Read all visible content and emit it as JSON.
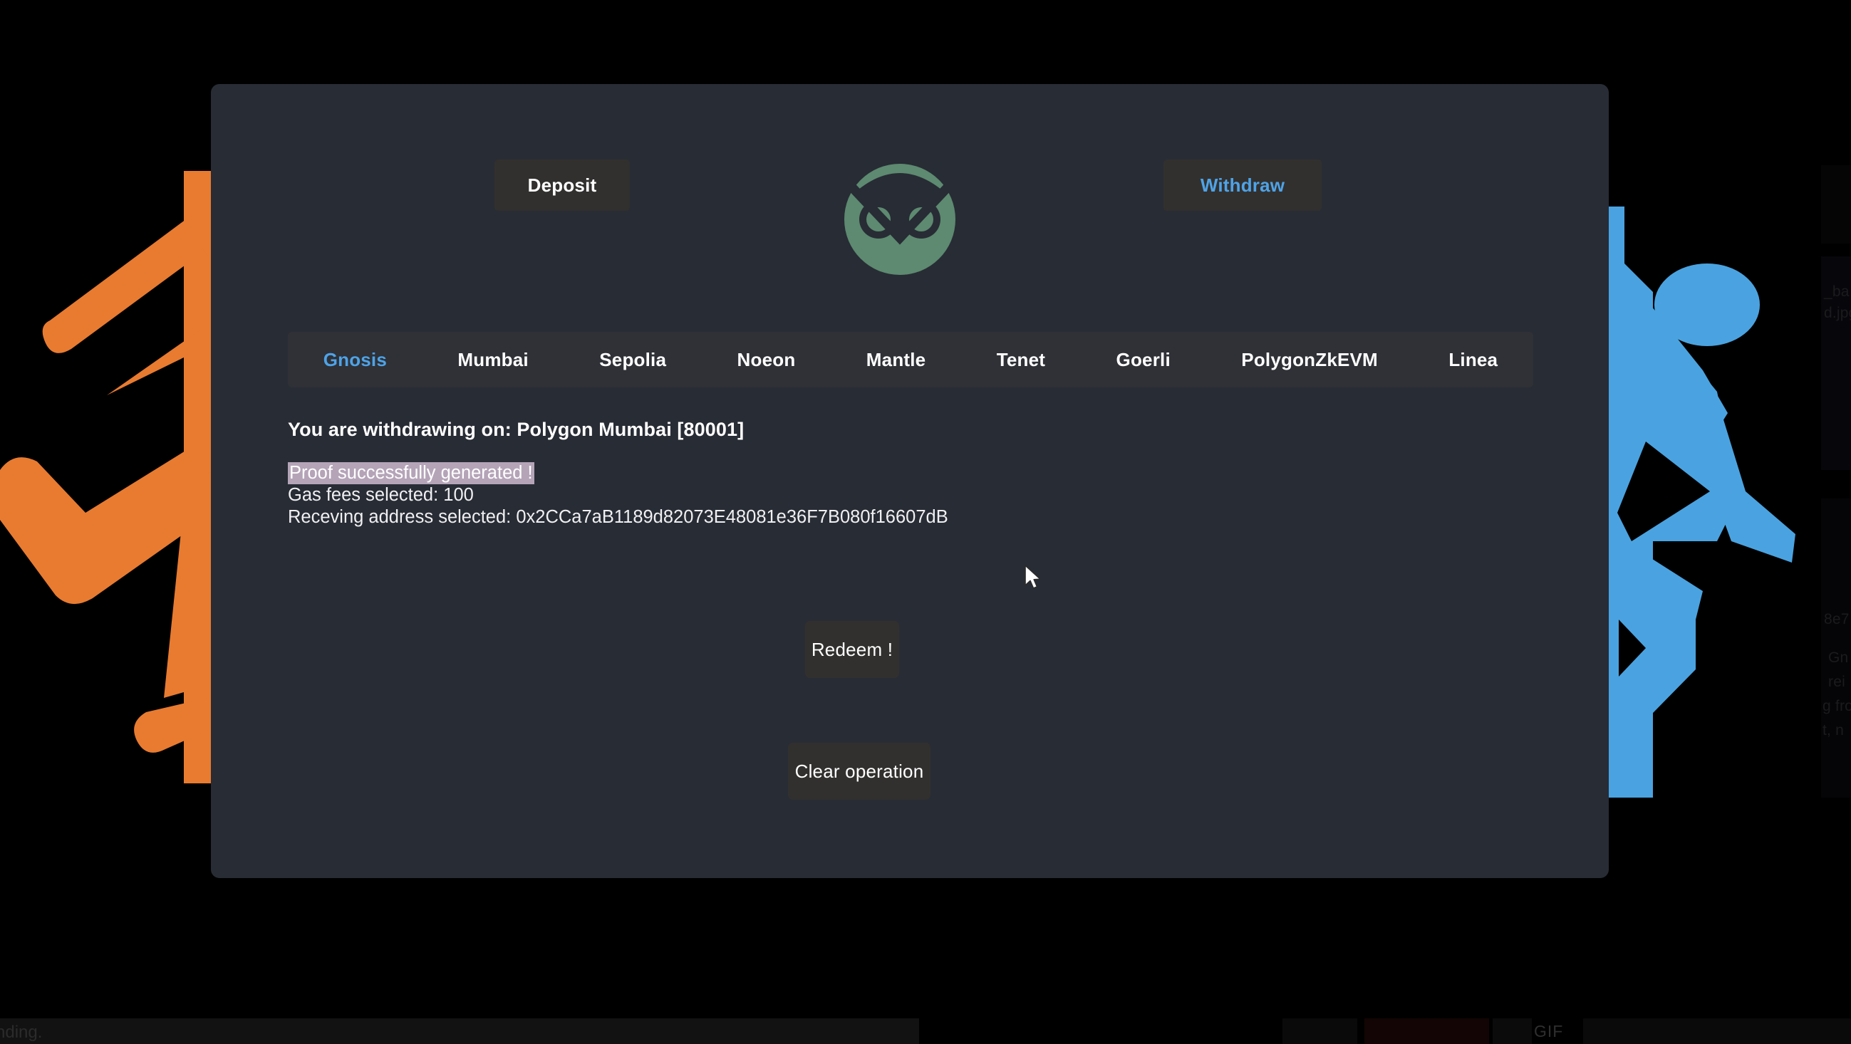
{
  "app": {
    "logo_icon": "owl-logo-icon",
    "logo_color": "#5d8a70",
    "card_bg": "#282c35",
    "accent_blue": "#4ea3e8",
    "button_bg": "#32302e"
  },
  "header": {
    "deposit_label": "Deposit",
    "withdraw_label": "Withdraw",
    "active_mode": "Withdraw"
  },
  "networks": {
    "active": "Gnosis",
    "tabs": [
      {
        "label": "Gnosis",
        "active": true
      },
      {
        "label": "Mumbai",
        "active": false
      },
      {
        "label": "Sepolia",
        "active": false
      },
      {
        "label": "Noeon",
        "active": false
      },
      {
        "label": "Mantle",
        "active": false
      },
      {
        "label": "Tenet",
        "active": false
      },
      {
        "label": "Goerli",
        "active": false
      },
      {
        "label": "PolygonZkEVM",
        "active": false
      },
      {
        "label": "Linea",
        "active": false
      }
    ]
  },
  "status": {
    "headline": "You are withdrawing on: Polygon Mumbai [80001]",
    "proof_message": "Proof successfully generated !",
    "proof_highlight_color": "#b5a4b8",
    "gas_line": "Gas fees selected: 100",
    "address_line": "Receving address selected: 0x2CCa7aB1189d82073E48081e36F7B080f16607dB",
    "gas_fees_value": "100",
    "receiving_address": "0x2CCa7aB1189d82073E48081e36F7B080f16607dB",
    "network_name": "Polygon Mumbai",
    "chain_id": "80001"
  },
  "actions": {
    "redeem_label": "Redeem !",
    "clear_label": "Clear operation"
  },
  "background": {
    "left_figure_color": "#e87b30",
    "right_figure_color": "#4aa3e0",
    "edge_text": [
      "_ba",
      "d.jpg",
      "8e7",
      "Gn",
      "rei",
      "g fro",
      "t, n"
    ],
    "bottom_cut_word": "nding.",
    "gif_badge": "GIF"
  }
}
